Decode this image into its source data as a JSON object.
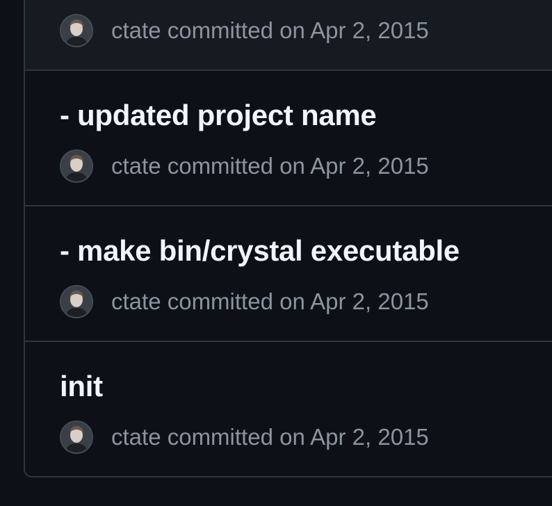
{
  "commits": [
    {
      "title": "",
      "author": "ctate",
      "verb": "committed",
      "date": "on Apr 2, 2015"
    },
    {
      "title": "- updated project name",
      "author": "ctate",
      "verb": "committed",
      "date": "on Apr 2, 2015"
    },
    {
      "title": "- make bin/crystal executable",
      "author": "ctate",
      "verb": "committed",
      "date": "on Apr 2, 2015"
    },
    {
      "title": "init",
      "author": "ctate",
      "verb": "committed",
      "date": "on Apr 2, 2015"
    }
  ],
  "colors": {
    "background": "#0d1117",
    "border": "#30363d",
    "title": "#f0f6fc",
    "meta": "#8b949e",
    "highlight_row": "#161b22"
  },
  "icons": {
    "avatar": "user-avatar-icon"
  }
}
